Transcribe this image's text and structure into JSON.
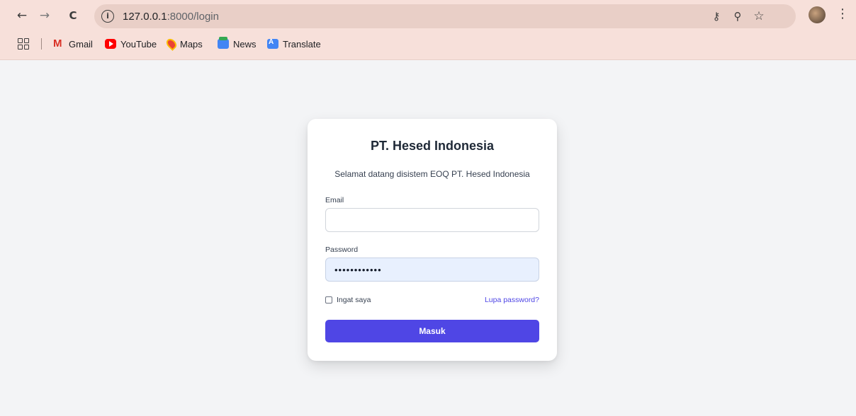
{
  "browser": {
    "url_host": "127.0.0.1",
    "url_rest": ":8000/login",
    "back_glyph": "←",
    "forward_glyph": "→",
    "reload_glyph": "C",
    "info_glyph": "i",
    "key_glyph": "⚷",
    "zoom_glyph": "⚲",
    "star_glyph": "☆",
    "menu_glyph": "⋮",
    "icons": [
      "back-arrow-icon",
      "forward-arrow-icon",
      "reload-icon",
      "site-info-icon",
      "password-key-icon",
      "zoom-icon",
      "bookmark-star-icon",
      "profile-avatar",
      "menu-icon"
    ]
  },
  "bookmarks": {
    "items": [
      {
        "label": "Gmail",
        "icon": "gmail-icon"
      },
      {
        "label": "YouTube",
        "icon": "youtube-icon"
      },
      {
        "label": "Maps",
        "icon": "maps-icon"
      },
      {
        "label": "News",
        "icon": "news-icon"
      },
      {
        "label": "Translate",
        "icon": "translate-icon"
      }
    ],
    "gmail_glyph": "M"
  },
  "login": {
    "title": "PT. Hesed Indonesia",
    "subtitle": "Selamat datang disistem EOQ PT. Hesed Indonesia",
    "email_label": "Email",
    "email_value": "",
    "password_label": "Password",
    "password_value": "••••••••••••",
    "remember_label": "Ingat saya",
    "forgot_label": "Lupa password?",
    "submit_label": "Masuk"
  },
  "colors": {
    "chrome_bg": "#f7e0da",
    "page_bg": "#f3f4f6",
    "accent": "#4f46e5",
    "autofill_bg": "#e8f0fe"
  }
}
